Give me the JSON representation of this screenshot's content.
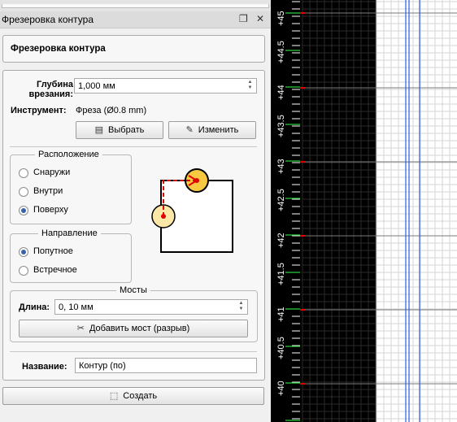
{
  "window": {
    "title": "Фрезеровка контура"
  },
  "header": {
    "title": "Фрезеровка контура"
  },
  "depth": {
    "label": "Глубина врезания:",
    "value": "1,000 мм"
  },
  "tool": {
    "label": "Инструмент:",
    "value": "Фреза (Ø0.8 mm)",
    "select_label": "Выбрать",
    "edit_label": "Изменить"
  },
  "placement": {
    "title": "Расположение",
    "options": [
      "Снаружи",
      "Внутри",
      "Поверху"
    ],
    "selected": "Поверху"
  },
  "direction": {
    "title": "Направление",
    "options": [
      "Попутное",
      "Встречное"
    ],
    "selected": "Попутное"
  },
  "bridges": {
    "title": "Мосты",
    "length_label": "Длина:",
    "length_value": "0, 10 мм",
    "add_label": "Добавить мост (разрыв)"
  },
  "name": {
    "label": "Название:",
    "value": "Контур (по)"
  },
  "create_label": "Создать",
  "ruler": {
    "labels": [
      "+45",
      "+44.5",
      "+44",
      "+43.5",
      "+43",
      "+42.5",
      "+42",
      "+41.5",
      "+41",
      "+40.5",
      "+40",
      "5"
    ]
  },
  "colors": {
    "canvas_bg": "#000000",
    "grid_bg": "#ffffff",
    "accent_blue": "#2b5fd9",
    "tool_fill": "#f7c842",
    "path_red": "#e00000"
  }
}
